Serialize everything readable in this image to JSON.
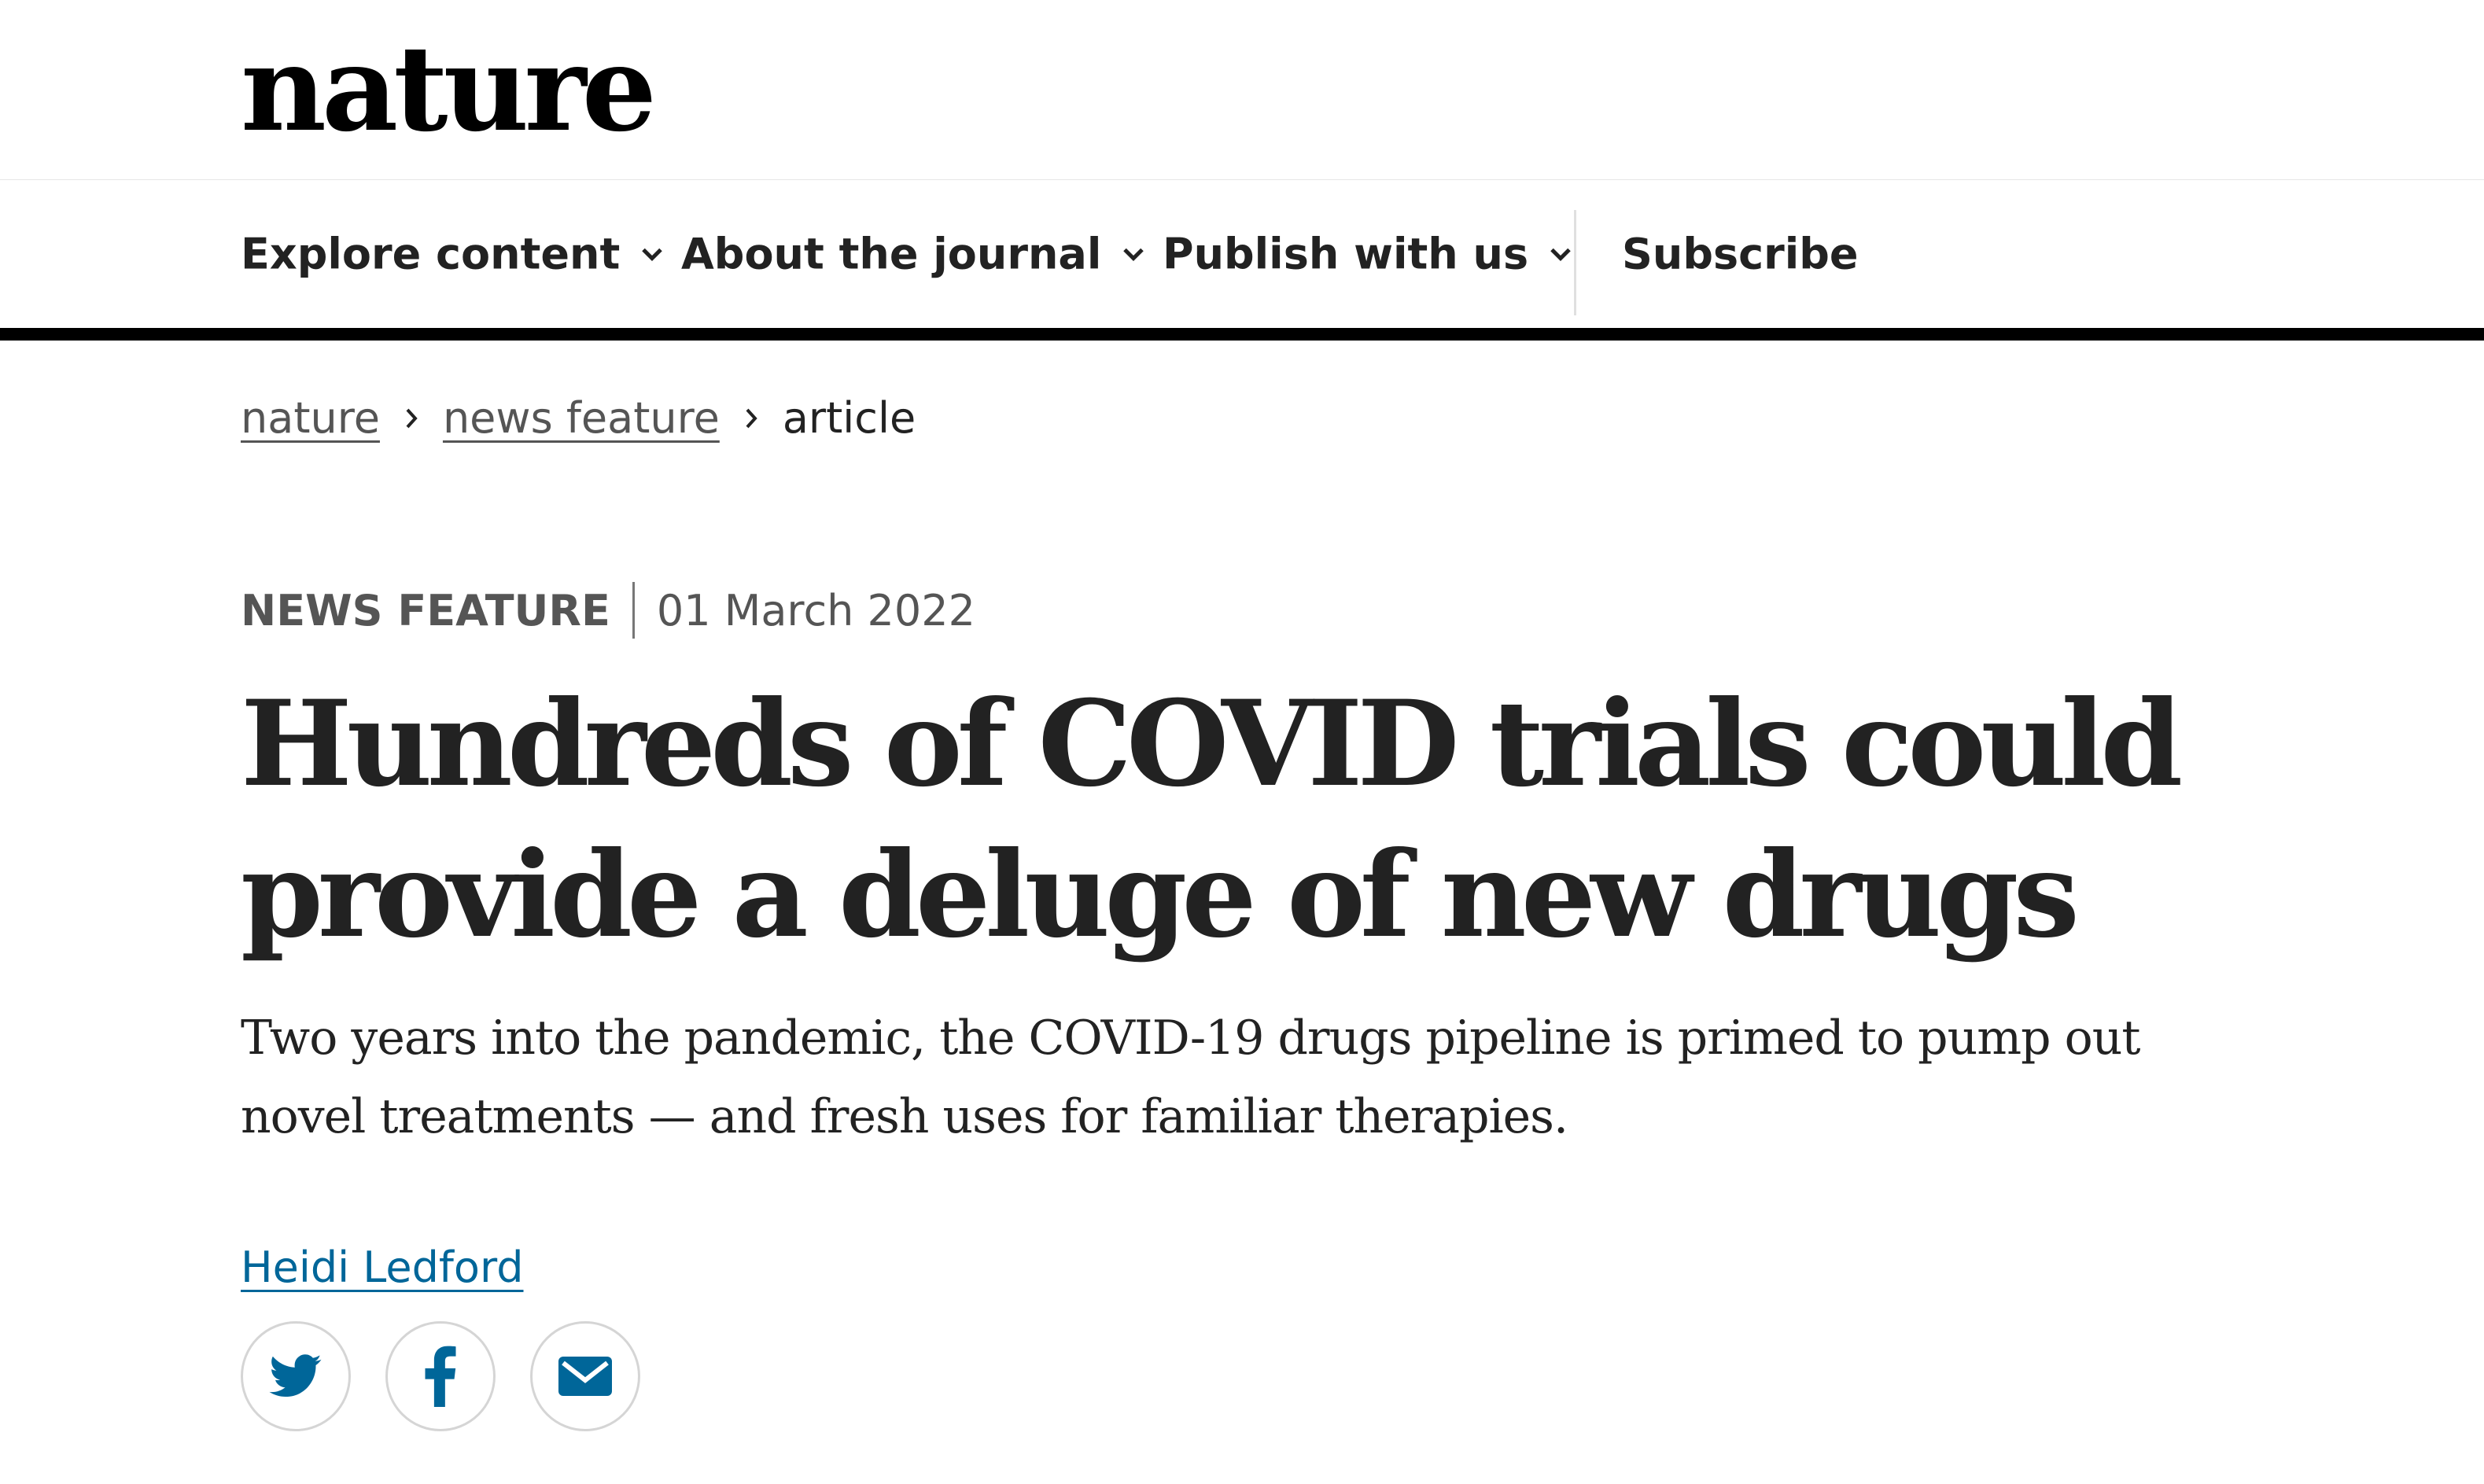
{
  "brand": {
    "logo_text": "nature"
  },
  "nav": {
    "items": [
      {
        "label": "Explore content",
        "has_dropdown": true
      },
      {
        "label": "About the journal",
        "has_dropdown": true
      },
      {
        "label": "Publish with us",
        "has_dropdown": true
      },
      {
        "label": "Subscribe",
        "has_dropdown": false
      }
    ]
  },
  "breadcrumb": {
    "items": [
      {
        "label": "nature",
        "link": true
      },
      {
        "label": "news feature",
        "link": true
      },
      {
        "label": "article",
        "link": false
      }
    ]
  },
  "article": {
    "type": "NEWS FEATURE",
    "date": "01 March 2022",
    "title": "Hundreds of COVID trials could provide a deluge of new drugs",
    "standfirst": "Two years into the pandemic, the COVID-19 drugs pipeline is primed to pump out novel treatments — and fresh uses for familiar therapies.",
    "author": "Heidi Ledford"
  },
  "share": {
    "icons": [
      "twitter-icon",
      "facebook-icon",
      "email-icon"
    ],
    "icon_color": "#006699"
  },
  "colors": {
    "text": "#222222",
    "link": "#006699",
    "muted": "#555555",
    "nav_rule": "#000000"
  }
}
